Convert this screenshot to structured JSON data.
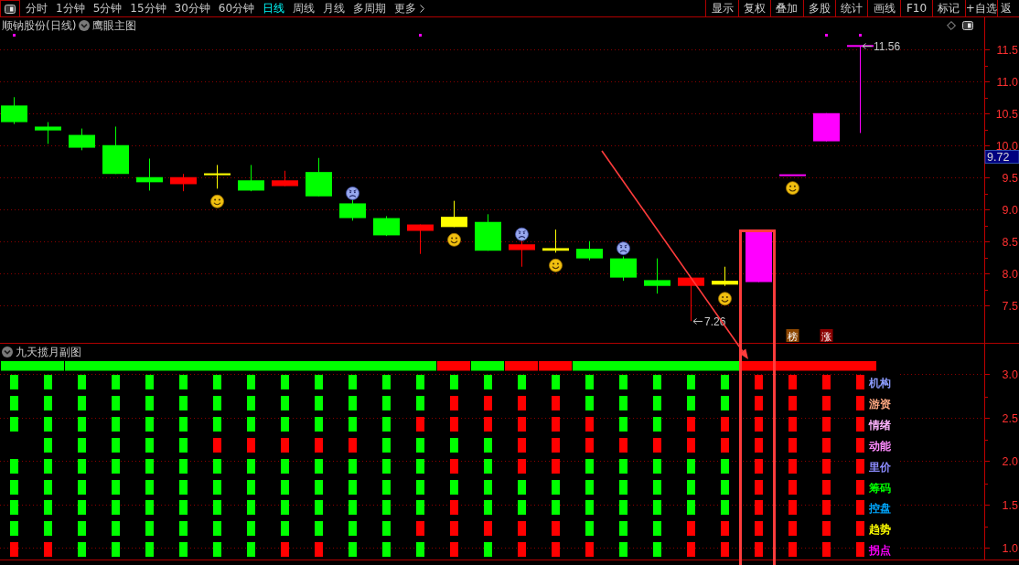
{
  "toolbar": {
    "tabs": [
      {
        "label": "分时",
        "selected": false,
        "kind": "period"
      },
      {
        "label": "1分钟",
        "selected": false,
        "kind": "period"
      },
      {
        "label": "5分钟",
        "selected": false,
        "kind": "period"
      },
      {
        "label": "15分钟",
        "selected": false,
        "kind": "period"
      },
      {
        "label": "30分钟",
        "selected": false,
        "kind": "period"
      },
      {
        "label": "60分钟",
        "selected": false,
        "kind": "period"
      },
      {
        "label": "日线",
        "selected": true,
        "kind": "period"
      },
      {
        "label": "周线",
        "selected": false,
        "kind": "period"
      },
      {
        "label": "月线",
        "selected": false,
        "kind": "period"
      },
      {
        "label": "多周期",
        "selected": false,
        "kind": "period"
      },
      {
        "label": "更多",
        "selected": false,
        "kind": "menu"
      }
    ],
    "buttons": [
      "显示",
      "复权",
      "叠加",
      "多股",
      "统计",
      "画线",
      "F10",
      "标记",
      "+自选",
      "返"
    ]
  },
  "main_chart": {
    "title": "顺钠股份(日线)",
    "indicator": "鹰眼主图",
    "chart_data": [
      {
        "type": "candlestick",
        "categories": [
          null,
          null,
          null,
          null,
          null,
          null,
          null,
          null,
          null,
          null,
          null,
          null,
          null,
          null,
          null,
          null,
          null,
          null,
          null,
          null,
          null,
          null,
          null,
          null,
          null,
          null,
          null,
          null,
          null
        ],
        "ohlc": [
          [
            10.63,
            10.76,
            10.34,
            10.37
          ],
          [
            10.3,
            10.37,
            10.03,
            10.24
          ],
          [
            10.17,
            10.27,
            9.93,
            9.97
          ],
          [
            10.01,
            10.3,
            9.56,
            9.56
          ],
          [
            9.51,
            9.8,
            9.3,
            9.43
          ],
          [
            9.4,
            9.56,
            9.29,
            9.51
          ],
          [
            9.54,
            9.7,
            9.33,
            9.57
          ],
          [
            9.46,
            9.7,
            9.29,
            9.3
          ],
          [
            9.37,
            9.61,
            9.37,
            9.46
          ],
          [
            9.59,
            9.81,
            9.21,
            9.21
          ],
          [
            9.1,
            9.16,
            8.83,
            8.87
          ],
          [
            8.87,
            8.9,
            8.59,
            8.6
          ],
          [
            8.67,
            8.77,
            8.31,
            8.77
          ],
          [
            8.73,
            9.14,
            8.73,
            8.89
          ],
          [
            8.81,
            8.93,
            8.36,
            8.36
          ],
          [
            8.37,
            8.54,
            8.11,
            8.46
          ],
          [
            8.36,
            8.69,
            8.33,
            8.4
          ],
          [
            8.39,
            8.51,
            8.21,
            8.24
          ],
          [
            8.24,
            8.27,
            7.89,
            7.94
          ],
          [
            7.9,
            8.24,
            7.69,
            7.81
          ],
          [
            7.81,
            7.94,
            7.26,
            7.94
          ],
          [
            7.83,
            8.11,
            7.81,
            7.89
          ],
          [
            7.87,
            8.66,
            7.87,
            8.66
          ],
          [
            9.54,
            9.54,
            9.54,
            9.54
          ],
          [
            10.07,
            10.51,
            10.07,
            10.51
          ],
          [
            11.56,
            11.56,
            10.2,
            11.56
          ],
          null,
          null,
          null
        ],
        "colors": [
          "#00ff00",
          "#00ff00",
          "#00ff00",
          "#00ff00",
          "#00ff00",
          "#ff0000",
          "#ffff00",
          "#00ff00",
          "#ff0000",
          "#00ff00",
          "#00ff00",
          "#00ff00",
          "#ff0000",
          "#ffff00",
          "#00ff00",
          "#ff0000",
          "#ffff00",
          "#00ff00",
          "#00ff00",
          "#00ff00",
          "#ff0000",
          "#ffff00",
          "#ff00ff",
          "#ff00ff",
          "#ff00ff",
          "#ff00ff",
          null,
          null,
          null
        ],
        "ylim": [
          6.92,
          11.75
        ],
        "yticks": [
          {
            "value": 11.5,
            "label": "11.5"
          },
          {
            "value": 11,
            "label": "11.0"
          },
          {
            "value": 10.5,
            "label": "10.5"
          },
          {
            "value": 10,
            "label": "10.0"
          },
          {
            "value": 9.5,
            "label": "9.5"
          },
          {
            "value": 9,
            "label": "9.0"
          },
          {
            "value": 8.5,
            "label": "8.5"
          },
          {
            "value": 8,
            "label": "8.0"
          },
          {
            "value": 7.5,
            "label": "7.5"
          }
        ],
        "grid": true,
        "annotations": [
          "11.56",
          "7.26"
        ]
      }
    ],
    "price_tag": "9.72",
    "signals": [
      {
        "kind": "plain",
        "dot": true
      },
      {
        "kind": "plain",
        "dot": false
      },
      {
        "kind": "plain",
        "dot": false
      },
      {
        "kind": "plain",
        "dot": false
      },
      {
        "kind": "plain",
        "dot": false
      },
      {
        "kind": "plain",
        "dot": false
      },
      {
        "kind": "smile",
        "dot": false
      },
      {
        "kind": "plain",
        "dot": false
      },
      {
        "kind": "plain",
        "dot": false
      },
      {
        "kind": "plain",
        "dot": false
      },
      {
        "kind": "frown",
        "dot": false
      },
      {
        "kind": "plain",
        "dot": false
      },
      {
        "kind": "plain",
        "dot": true
      },
      {
        "kind": "smile",
        "dot": false
      },
      {
        "kind": "plain",
        "dot": false
      },
      {
        "kind": "frown",
        "dot": false
      },
      {
        "kind": "smile",
        "dot": false
      },
      {
        "kind": "plain",
        "dot": false
      },
      {
        "kind": "frown",
        "dot": false
      },
      {
        "kind": "plain",
        "dot": false
      },
      {
        "kind": "plain",
        "dot": false
      },
      {
        "kind": "smile",
        "dot": false
      },
      {
        "kind": "plain",
        "dot": false
      },
      {
        "kind": "smile",
        "dot": false,
        "badge": {
          "text": "榜",
          "color": "#8b4500"
        }
      },
      {
        "kind": "plain",
        "dot": true,
        "badge": {
          "text": "涨",
          "color": "#8b0000"
        }
      },
      {
        "kind": "plain",
        "dot": true
      }
    ]
  },
  "sub_chart": {
    "title": "九天揽月副图",
    "trend_bar": [
      [
        {
          "color": "#00ff00"
        },
        {
          "color": "#00ff00"
        }
      ],
      [
        {
          "color": "#00ff00"
        },
        {
          "color": "#00ff00"
        },
        {
          "color": "#00ff00"
        },
        {
          "color": "#00ff00"
        },
        {
          "color": "#00ff00"
        },
        {
          "color": "#00ff00"
        },
        {
          "color": "#00ff00"
        },
        {
          "color": "#00ff00"
        },
        {
          "color": "#00ff00"
        },
        {
          "color": "#00ff00"
        },
        {
          "color": "#00ff00"
        }
      ],
      [
        {
          "color": "#ff0000"
        }
      ],
      [
        {
          "color": "#00ff00"
        }
      ],
      [
        {
          "color": "#ff0000"
        }
      ],
      [
        {
          "color": "#ff0000"
        }
      ],
      [
        {
          "color": "#00ff00"
        },
        {
          "color": "#00ff00"
        },
        {
          "color": "#00ff00"
        },
        {
          "color": "#00ff00"
        },
        {
          "color": "#00ff00"
        }
      ],
      [
        {
          "color": "#ff0000"
        },
        {
          "color": "#ff0000"
        },
        {
          "color": "#ff0000"
        },
        {
          "color": "#ff0000"
        }
      ]
    ],
    "rows": [
      {
        "label": "机构",
        "color": "#8c9cff",
        "cells": [
          {
            "color": "#00ff00"
          },
          {
            "color": "#00ff00"
          },
          {
            "color": "#00ff00"
          },
          {
            "color": "#00ff00"
          },
          {
            "color": "#00ff00"
          },
          {
            "color": "#00ff00"
          },
          {
            "color": "#00ff00"
          },
          {
            "color": "#00ff00"
          },
          {
            "color": "#00ff00"
          },
          {
            "color": "#00ff00"
          },
          {
            "color": "#00ff00"
          },
          {
            "color": "#00ff00"
          },
          {
            "color": "#00ff00"
          },
          {
            "color": "#00ff00"
          },
          {
            "color": "#00ff00"
          },
          {
            "color": "#00ff00"
          },
          {
            "color": "#00ff00"
          },
          {
            "color": "#00ff00"
          },
          {
            "color": "#00ff00"
          },
          {
            "color": "#00ff00"
          },
          {
            "color": "#00ff00"
          },
          {
            "color": "#00ff00"
          },
          {
            "color": "#ff0000"
          },
          {
            "color": "#ff0000"
          },
          {
            "color": "#ff0000"
          },
          {
            "color": "#ff0000"
          }
        ]
      },
      {
        "label": "游资",
        "color": "#ffa882",
        "cells": [
          {
            "color": "#00ff00"
          },
          {
            "color": "#00ff00"
          },
          {
            "color": "#00ff00"
          },
          {
            "color": "#00ff00"
          },
          {
            "color": "#00ff00"
          },
          {
            "color": "#00ff00"
          },
          {
            "color": "#00ff00"
          },
          {
            "color": "#00ff00"
          },
          {
            "color": "#00ff00"
          },
          {
            "color": "#00ff00"
          },
          {
            "color": "#00ff00"
          },
          {
            "color": "#00ff00"
          },
          {
            "color": "#00ff00"
          },
          {
            "color": "#ff0000"
          },
          {
            "color": "#ff0000"
          },
          {
            "color": "#ff0000"
          },
          {
            "color": "#ff0000"
          },
          {
            "color": "#00ff00"
          },
          {
            "color": "#00ff00"
          },
          {
            "color": "#00ff00"
          },
          {
            "color": "#00ff00"
          },
          {
            "color": "#00ff00"
          },
          {
            "color": "#ff0000"
          },
          {
            "color": "#ff0000"
          },
          {
            "color": "#ff0000"
          },
          {
            "color": "#ff0000"
          }
        ]
      },
      {
        "label": "情绪",
        "color": "#ffb4ff",
        "cells": [
          {
            "color": "#00ff00"
          },
          {
            "color": "#00ff00"
          },
          {
            "color": "#00ff00"
          },
          {
            "color": "#00ff00"
          },
          {
            "color": "#00ff00"
          },
          {
            "color": "#00ff00"
          },
          {
            "color": "#00ff00"
          },
          {
            "color": "#00ff00"
          },
          {
            "color": "#00ff00"
          },
          {
            "color": "#00ff00"
          },
          {
            "color": "#00ff00"
          },
          {
            "color": "#00ff00"
          },
          {
            "color": "#ff0000"
          },
          {
            "color": "#ff0000"
          },
          {
            "color": "#ff0000"
          },
          {
            "color": "#ff0000"
          },
          {
            "color": "#ff0000"
          },
          {
            "color": "#ff0000"
          },
          {
            "color": "#00ff00"
          },
          {
            "color": "#00ff00"
          },
          {
            "color": "#ff0000"
          },
          {
            "color": "#ff0000"
          },
          {
            "color": "#ff0000"
          },
          {
            "color": "#ff0000"
          },
          {
            "color": "#ff0000"
          },
          {
            "color": "#ff0000"
          }
        ]
      },
      {
        "label": "动能",
        "color": "#ff8cff",
        "cells": [
          null,
          {
            "color": "#00ff00"
          },
          {
            "color": "#00ff00"
          },
          {
            "color": "#00ff00"
          },
          {
            "color": "#00ff00"
          },
          {
            "color": "#00ff00"
          },
          {
            "color": "#ff0000"
          },
          {
            "color": "#ff0000"
          },
          {
            "color": "#ff0000"
          },
          {
            "color": "#ff0000"
          },
          {
            "color": "#ff0000"
          },
          {
            "color": "#00ff00"
          },
          {
            "color": "#00ff00"
          },
          {
            "color": "#00ff00"
          },
          {
            "color": "#00ff00"
          },
          {
            "color": "#ff0000"
          },
          {
            "color": "#ff0000"
          },
          {
            "color": "#ff0000"
          },
          {
            "color": "#ff0000"
          },
          {
            "color": "#ff0000"
          },
          {
            "color": "#ff0000"
          },
          {
            "color": "#ff0000"
          },
          {
            "color": "#ff0000"
          },
          {
            "color": "#ff0000"
          },
          {
            "color": "#ff0000"
          },
          {
            "color": "#ff0000"
          }
        ]
      },
      {
        "label": "里价",
        "color": "#8c8cff",
        "cells": [
          {
            "color": "#00ff00"
          },
          {
            "color": "#00ff00"
          },
          {
            "color": "#00ff00"
          },
          {
            "color": "#00ff00"
          },
          {
            "color": "#00ff00"
          },
          {
            "color": "#00ff00"
          },
          {
            "color": "#00ff00"
          },
          {
            "color": "#00ff00"
          },
          {
            "color": "#00ff00"
          },
          {
            "color": "#00ff00"
          },
          {
            "color": "#00ff00"
          },
          {
            "color": "#00ff00"
          },
          {
            "color": "#00ff00"
          },
          {
            "color": "#ff0000"
          },
          {
            "color": "#00ff00"
          },
          {
            "color": "#ff0000"
          },
          {
            "color": "#ff0000"
          },
          {
            "color": "#00ff00"
          },
          {
            "color": "#00ff00"
          },
          {
            "color": "#00ff00"
          },
          {
            "color": "#00ff00"
          },
          {
            "color": "#00ff00"
          },
          {
            "color": "#ff0000"
          },
          {
            "color": "#ff0000"
          },
          {
            "color": "#ff0000"
          },
          {
            "color": "#ff0000"
          }
        ]
      },
      {
        "label": "筹码",
        "color": "#00ff00",
        "cells": [
          {
            "color": "#00ff00"
          },
          {
            "color": "#00ff00"
          },
          {
            "color": "#00ff00"
          },
          {
            "color": "#00ff00"
          },
          {
            "color": "#00ff00"
          },
          {
            "color": "#00ff00"
          },
          {
            "color": "#00ff00"
          },
          {
            "color": "#00ff00"
          },
          {
            "color": "#00ff00"
          },
          {
            "color": "#00ff00"
          },
          {
            "color": "#00ff00"
          },
          {
            "color": "#00ff00"
          },
          {
            "color": "#00ff00"
          },
          {
            "color": "#00ff00"
          },
          {
            "color": "#00ff00"
          },
          {
            "color": "#00ff00"
          },
          {
            "color": "#00ff00"
          },
          {
            "color": "#00ff00"
          },
          {
            "color": "#00ff00"
          },
          {
            "color": "#00ff00"
          },
          {
            "color": "#00ff00"
          },
          {
            "color": "#00ff00"
          },
          {
            "color": "#ff0000"
          },
          {
            "color": "#ff0000"
          },
          {
            "color": "#ff0000"
          },
          {
            "color": "#ff0000"
          }
        ]
      },
      {
        "label": "控盘",
        "color": "#00a8ff",
        "cells": [
          {
            "color": "#00ff00"
          },
          {
            "color": "#00ff00"
          },
          {
            "color": "#00ff00"
          },
          {
            "color": "#00ff00"
          },
          {
            "color": "#00ff00"
          },
          {
            "color": "#00ff00"
          },
          {
            "color": "#00ff00"
          },
          {
            "color": "#00ff00"
          },
          {
            "color": "#00ff00"
          },
          {
            "color": "#00ff00"
          },
          {
            "color": "#00ff00"
          },
          {
            "color": "#00ff00"
          },
          {
            "color": "#00ff00"
          },
          {
            "color": "#ff0000"
          },
          {
            "color": "#00ff00"
          },
          {
            "color": "#00ff00"
          },
          {
            "color": "#00ff00"
          },
          {
            "color": "#00ff00"
          },
          {
            "color": "#00ff00"
          },
          {
            "color": "#00ff00"
          },
          {
            "color": "#00ff00"
          },
          {
            "color": "#00ff00"
          },
          {
            "color": "#ff0000"
          },
          {
            "color": "#ff0000"
          },
          {
            "color": "#ff0000"
          },
          {
            "color": "#ff0000"
          }
        ]
      },
      {
        "label": "趋势",
        "color": "#ffff00",
        "cells": [
          {
            "color": "#00ff00"
          },
          {
            "color": "#00ff00"
          },
          {
            "color": "#00ff00"
          },
          {
            "color": "#00ff00"
          },
          {
            "color": "#00ff00"
          },
          {
            "color": "#00ff00"
          },
          {
            "color": "#00ff00"
          },
          {
            "color": "#00ff00"
          },
          {
            "color": "#00ff00"
          },
          {
            "color": "#00ff00"
          },
          {
            "color": "#00ff00"
          },
          {
            "color": "#00ff00"
          },
          {
            "color": "#ff0000"
          },
          {
            "color": "#ff0000"
          },
          {
            "color": "#ff0000"
          },
          {
            "color": "#ff0000"
          },
          {
            "color": "#ff0000"
          },
          {
            "color": "#00ff00"
          },
          {
            "color": "#00ff00"
          },
          {
            "color": "#00ff00"
          },
          {
            "color": "#ff0000"
          },
          {
            "color": "#ff0000"
          },
          {
            "color": "#ff0000"
          },
          {
            "color": "#ff0000"
          },
          {
            "color": "#ff0000"
          },
          {
            "color": "#ff0000"
          }
        ]
      },
      {
        "label": "拐点",
        "color": "#ff00ff",
        "cells": [
          {
            "color": "#ff0000"
          },
          {
            "color": "#ff0000"
          },
          {
            "color": "#00ff00"
          },
          {
            "color": "#00ff00"
          },
          {
            "color": "#00ff00"
          },
          {
            "color": "#00ff00"
          },
          {
            "color": "#00ff00"
          },
          {
            "color": "#00ff00"
          },
          {
            "color": "#ff0000"
          },
          {
            "color": "#ff0000"
          },
          {
            "color": "#00ff00"
          },
          {
            "color": "#00ff00"
          },
          {
            "color": "#00ff00"
          },
          {
            "color": "#ff0000"
          },
          {
            "color": "#00ff00"
          },
          {
            "color": "#ff0000"
          },
          {
            "color": "#ff0000"
          },
          {
            "color": "#ff0000"
          },
          {
            "color": "#00ff00"
          },
          {
            "color": "#00ff00"
          },
          {
            "color": "#ff0000"
          },
          {
            "color": "#ff0000"
          },
          {
            "color": "#ff0000"
          },
          {
            "color": "#ff0000"
          },
          {
            "color": "#ff0000"
          },
          {
            "color": "#ff0000"
          }
        ]
      }
    ],
    "axis_labels": [
      "3.0",
      "2.5",
      "2.0",
      "1.5",
      "1.0"
    ]
  }
}
